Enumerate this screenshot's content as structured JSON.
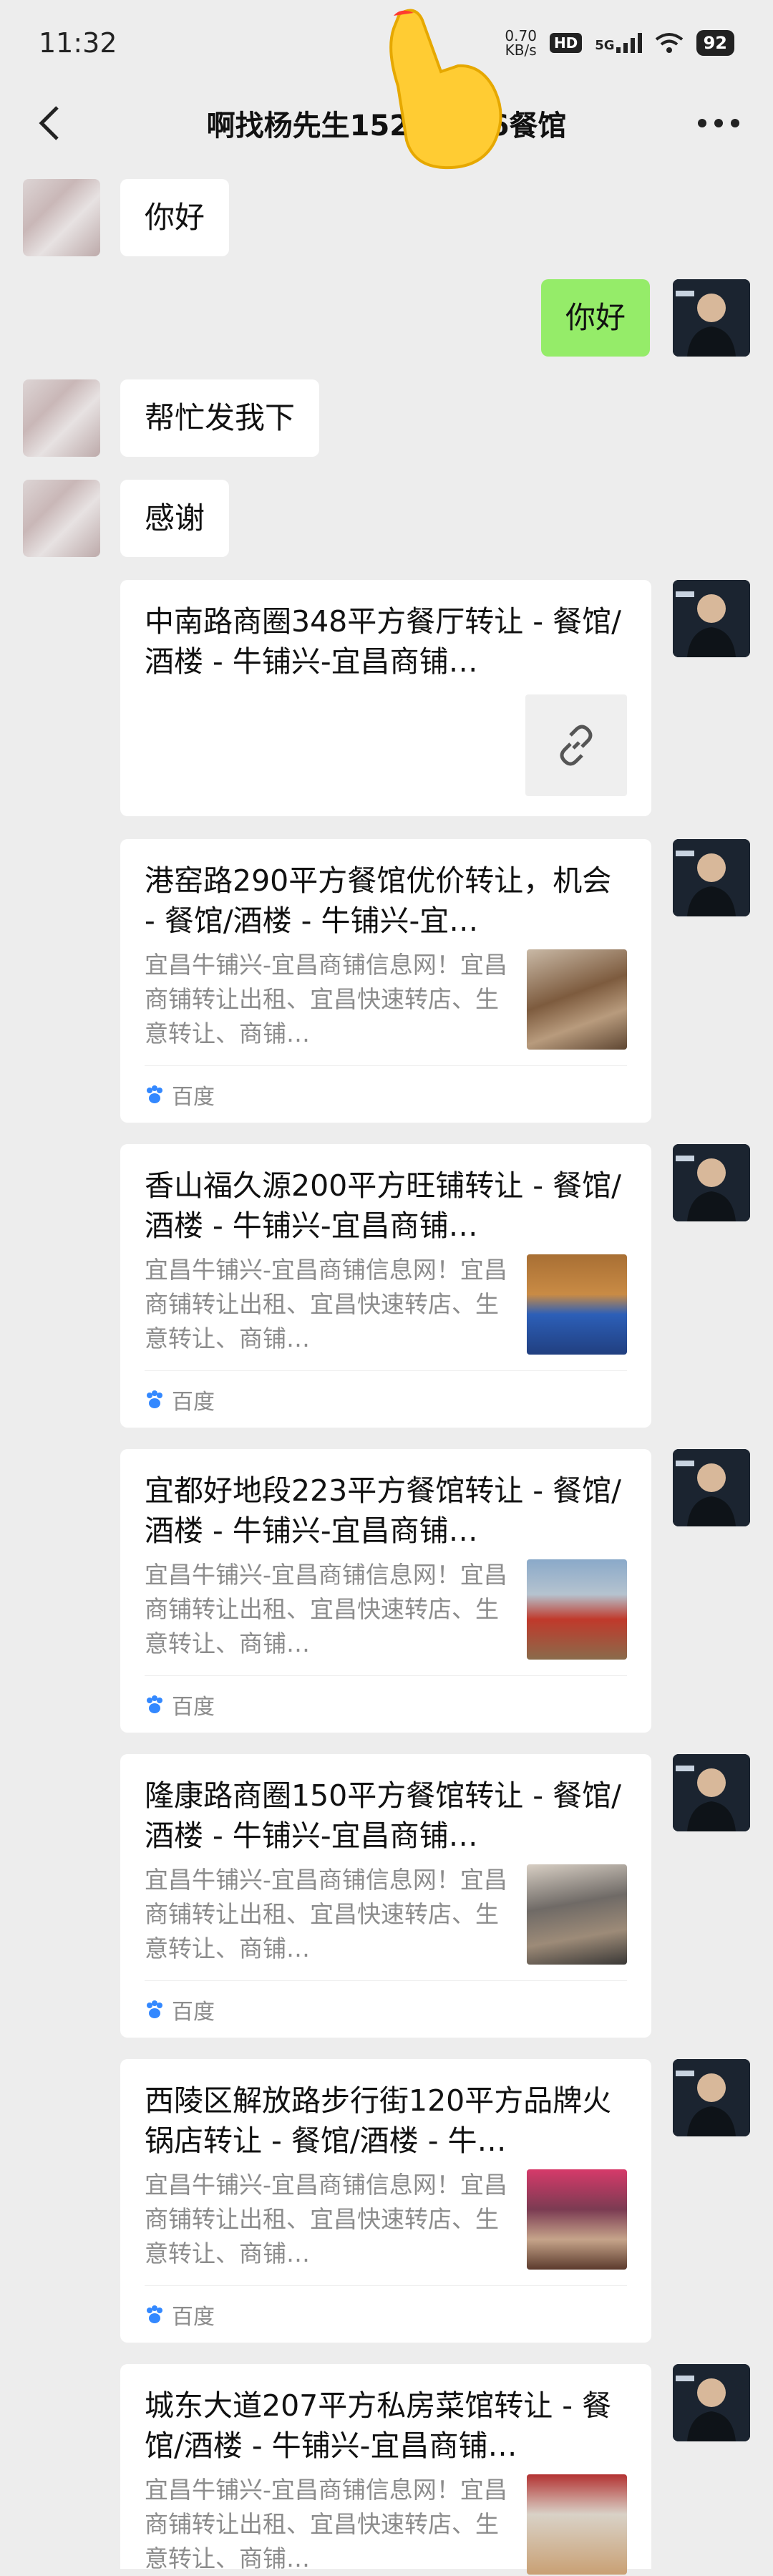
{
  "status": {
    "time": "11:32",
    "net_speed": "0.70\nKB/s",
    "hd": "HD",
    "signal": "5G",
    "battery": "92"
  },
  "header": {
    "title": "啊找杨先生152        6餐馆"
  },
  "messages": [
    {
      "text": "你好"
    },
    {
      "text": "你好"
    },
    {
      "text": "帮忙发我下"
    },
    {
      "text": "感谢"
    }
  ],
  "cards": [
    {
      "title": "中南路商圈348平方餐厅转让 - 餐馆/酒楼 - 牛铺兴-宜昌商铺…"
    },
    {
      "title": "港窑路290平方餐馆优价转让，机会 - 餐馆/酒楼 - 牛铺兴-宜…",
      "desc": "宜昌牛铺兴-宜昌商铺信息网！宜昌商铺转让出租、宜昌快速转店、生意转让、商铺…",
      "source": "百度"
    },
    {
      "title": "香山福久源200平方旺铺转让 - 餐馆/酒楼 - 牛铺兴-宜昌商铺…",
      "desc": "宜昌牛铺兴-宜昌商铺信息网！宜昌商铺转让出租、宜昌快速转店、生意转让、商铺…",
      "source": "百度"
    },
    {
      "title": "宜都好地段223平方餐馆转让 - 餐馆/酒楼 - 牛铺兴-宜昌商铺…",
      "desc": "宜昌牛铺兴-宜昌商铺信息网！宜昌商铺转让出租、宜昌快速转店、生意转让、商铺…",
      "source": "百度"
    },
    {
      "title": "隆康路商圈150平方餐馆转让 - 餐馆/酒楼 - 牛铺兴-宜昌商铺…",
      "desc": "宜昌牛铺兴-宜昌商铺信息网！宜昌商铺转让出租、宜昌快速转店、生意转让、商铺…",
      "source": "百度"
    },
    {
      "title": "西陵区解放路步行街120平方品牌火锅店转让 - 餐馆/酒楼 - 牛…",
      "desc": "宜昌牛铺兴-宜昌商铺信息网！宜昌商铺转让出租、宜昌快速转店、生意转让、商铺…",
      "source": "百度"
    },
    {
      "title": "城东大道207平方私房菜馆转让 - 餐馆/酒楼 - 牛铺兴-宜昌商铺…",
      "desc": "宜昌牛铺兴-宜昌商铺信息网！宜昌商铺转让出租、宜昌快速转店、生意转让、商铺…"
    }
  ],
  "icons": {
    "back": "chevron-left-icon",
    "more": "more-dots-icon",
    "link": "link-icon",
    "baidu": "baidu-paw-icon"
  }
}
